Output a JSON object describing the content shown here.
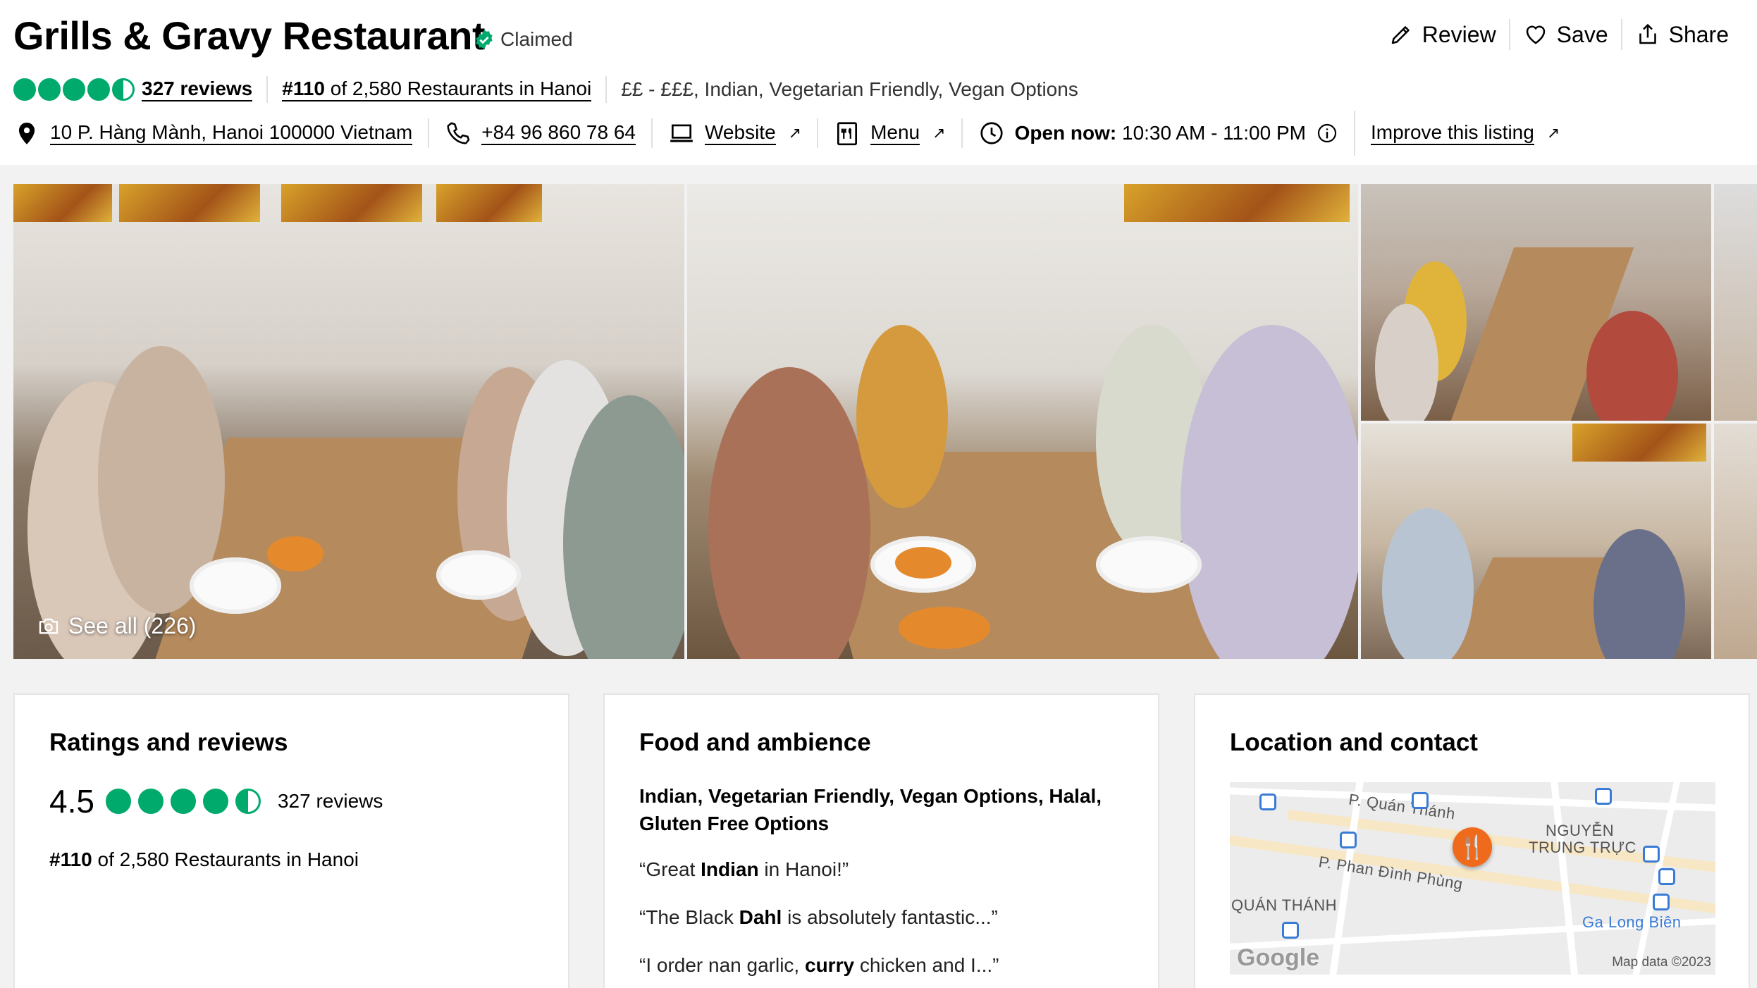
{
  "restaurant": {
    "name": "Grills & Gravy Restaurant",
    "claimed_label": "Claimed",
    "review_count_label": "327 reviews",
    "rating": 4.5,
    "rank_prefix": "#110",
    "rank_suffix": "of 2,580 Restaurants in Hanoi",
    "price_and_cuisine": "££ - £££, Indian, Vegetarian Friendly, Vegan Options"
  },
  "actions": {
    "review_label": "Review",
    "save_label": "Save",
    "share_label": "Share"
  },
  "details": {
    "address": "10 P. Hàng Mành, Hanoi 100000 Vietnam",
    "phone": "+84 96 860 78 64",
    "website_label": "Website",
    "menu_label": "Menu",
    "open_label": "Open now:",
    "hours": "10:30 AM - 11:00 PM",
    "improve_label": "Improve this listing"
  },
  "gallery": {
    "see_all_label": "See all (226)"
  },
  "ratings_card": {
    "title": "Ratings and reviews",
    "score": "4.5",
    "reviews_label": "327 reviews",
    "rank_prefix": "#110",
    "rank_suffix": "of 2,580 Restaurants in Hanoi"
  },
  "food_card": {
    "title": "Food and ambience",
    "cuisines": "Indian, Vegetarian Friendly, Vegan Options, Halal, Gluten Free Options",
    "quotes": [
      {
        "pre": "“Great ",
        "bold": "Indian",
        "post": " in Hanoi!”"
      },
      {
        "pre": "“The Black ",
        "bold": "Dahl",
        "post": " is absolutely fantastic...”"
      },
      {
        "pre": "“I order nan garlic, ",
        "bold": "curry",
        "post": " chicken and I...”"
      }
    ]
  },
  "location_card": {
    "title": "Location and contact",
    "map_labels": {
      "street1": "P. Quán Thánh",
      "street2": "P. Phan Đình Phùng",
      "district1": "NGUYỄN",
      "district2": "TRUNG TRỰC",
      "district3": "QUÁN THÁNH",
      "station": "Ga Long Biên",
      "google": "Google",
      "map_data": "Map data ©2023"
    }
  },
  "colors": {
    "bubble_green": "#00aa6c",
    "claimed_green": "#00aa6c",
    "pin_orange": "#f06a1c"
  },
  "icons": [
    "pencil-icon",
    "heart-icon",
    "share-icon",
    "location-pin-icon",
    "phone-icon",
    "laptop-icon",
    "menu-icon",
    "clock-icon",
    "info-icon",
    "camera-icon",
    "claimed-check-icon"
  ]
}
